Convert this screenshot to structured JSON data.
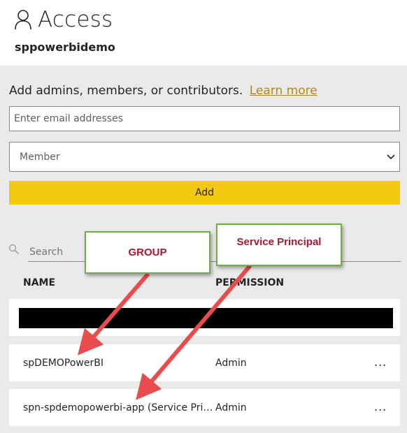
{
  "header": {
    "title": "Access",
    "workspace_name": "sppowerbidemo"
  },
  "add_section": {
    "prompt": "Add admins, members, or contributors.",
    "learn_more": "Learn more",
    "email_placeholder": "Enter email addresses",
    "role_selected": "Member",
    "add_button": "Add"
  },
  "search": {
    "placeholder": "Search"
  },
  "table": {
    "columns": {
      "name": "NAME",
      "permission": "PERMISSION"
    },
    "rows": [
      {
        "name": "",
        "permission": "",
        "redacted": true
      },
      {
        "name": "spDEMOPowerBI",
        "permission": "Admin",
        "more": "..."
      },
      {
        "name": "spn-spdemopowerbi-app (Service Principal)",
        "permission": "Admin",
        "more": "..."
      }
    ]
  },
  "annotations": {
    "group_label": "GROUP",
    "service_principal_label": "Service Principal"
  },
  "colors": {
    "accent_yellow": "#f2c811",
    "panel_bg": "#eaeaea",
    "link": "#b8860b",
    "callout_border": "#70ad47",
    "callout_text": "#a5192e",
    "arrow": "#e84c4c"
  }
}
